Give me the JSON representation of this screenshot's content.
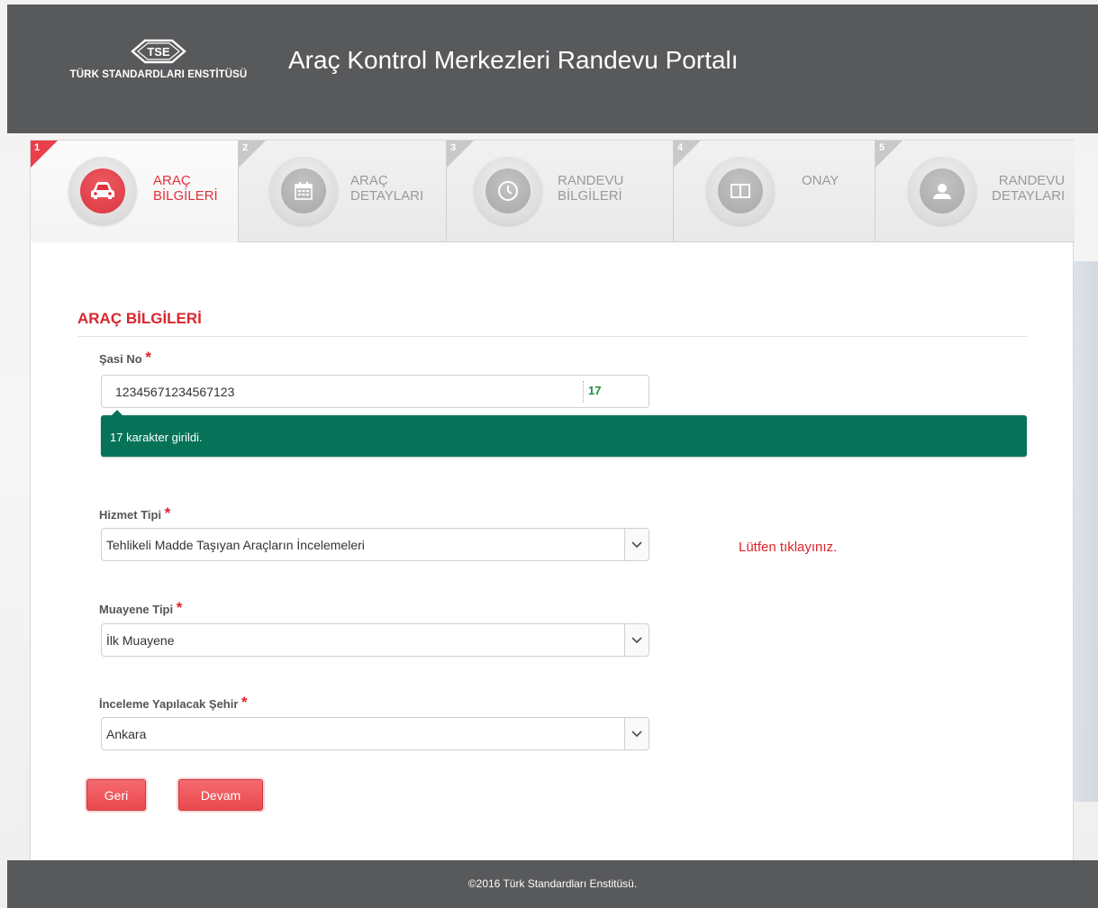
{
  "header": {
    "logo_mark": "TSE",
    "logo_text": "TÜRK STANDARDLARI ENSTİTÜSÜ",
    "title": "Araç Kontrol Merkezleri Randevu Portalı"
  },
  "steps": [
    {
      "num": "1",
      "line1": "ARAÇ",
      "line2": "BİLGİLERİ",
      "icon": "car-icon",
      "active": true
    },
    {
      "num": "2",
      "line1": "ARAÇ",
      "line2": "DETAYLARI",
      "icon": "calendar-icon",
      "active": false
    },
    {
      "num": "3",
      "line1": "RANDEVU",
      "line2": "BİLGİLERİ",
      "icon": "clock-icon",
      "active": false
    },
    {
      "num": "4",
      "line1": "ONAY",
      "line2": "",
      "icon": "book-icon",
      "active": false
    },
    {
      "num": "5",
      "line1": "RANDEVU",
      "line2": "DETAYLARI",
      "icon": "user-icon",
      "active": false
    }
  ],
  "form": {
    "section_title": "ARAÇ BİLGİLERİ",
    "chassis": {
      "label": "Şasi No",
      "required_mark": "*",
      "value": "12345671234567123",
      "count": "17",
      "tooltip": "17 karakter girildi."
    },
    "service_type": {
      "label": "Hizmet Tipi",
      "required_mark": "*",
      "selected": "Tehlikeli Madde Taşıyan Araçların İncelemeleri",
      "hint": "Lütfen tıklayınız."
    },
    "inspection_type": {
      "label": "Muayene Tipi",
      "required_mark": "*",
      "selected": "İlk Muayene"
    },
    "city": {
      "label": "İnceleme Yapılacak Şehir",
      "required_mark": "*",
      "selected": "Ankara"
    },
    "back_label": "Geri",
    "next_label": "Devam"
  },
  "footer": {
    "text": "©2016 Türk Standardları Enstitüsü."
  },
  "colors": {
    "header_bg": "#58595b",
    "accent_red": "#e0323b",
    "tooltip_green": "#067359",
    "counter_green": "#1e8f3a"
  }
}
